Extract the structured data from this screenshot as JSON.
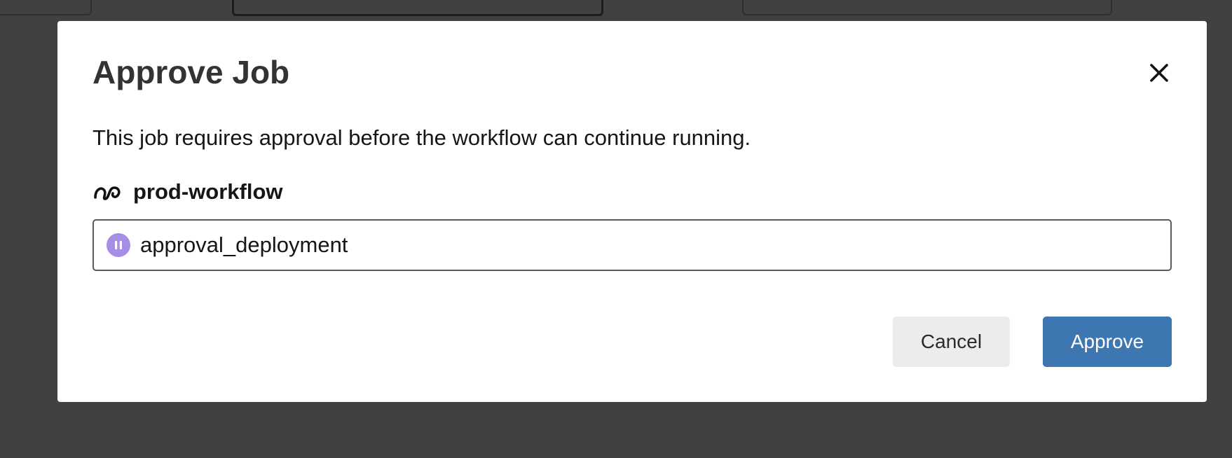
{
  "dialog": {
    "title": "Approve Job",
    "description": "This job requires approval before the workflow can continue running.",
    "workflow": {
      "icon": "workflow-icon",
      "name": "prod-workflow"
    },
    "job": {
      "status_icon": "on-hold-icon",
      "status_color": "#a68ee6",
      "name": "approval_deployment"
    },
    "close_icon": "close-icon",
    "buttons": {
      "cancel_label": "Cancel",
      "approve_label": "Approve"
    },
    "colors": {
      "approve": "#3e76b2",
      "cancel": "#ececec",
      "overlay": "#414141"
    }
  }
}
